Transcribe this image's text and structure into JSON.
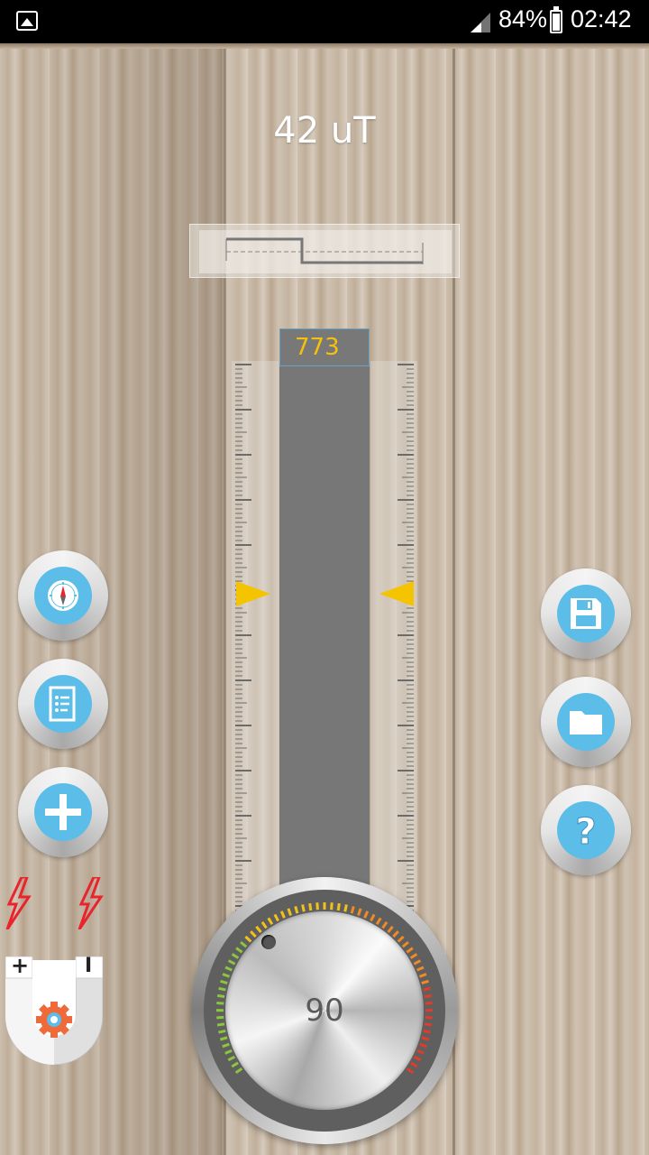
{
  "status_bar": {
    "battery_percent": "84%",
    "time": "02:42"
  },
  "meter": {
    "reading": "42 uT",
    "bar_value": "773",
    "dial_value": "90"
  },
  "left_buttons": [
    {
      "name": "compass-button",
      "icon": "compass-icon"
    },
    {
      "name": "notes-button",
      "icon": "document-list-icon"
    },
    {
      "name": "add-button",
      "icon": "plus-icon"
    }
  ],
  "right_buttons": [
    {
      "name": "save-button",
      "icon": "floppy-disk-icon"
    },
    {
      "name": "open-folder-button",
      "icon": "folder-icon"
    },
    {
      "name": "help-button",
      "icon": "question-mark-icon"
    }
  ],
  "magnet": {
    "plus_label": "+",
    "minus_label": "I"
  },
  "colors": {
    "accent_blue": "#5bbde8",
    "value_yellow": "#f6c10c",
    "arrow_yellow": "#f5c400",
    "bolt_red": "#e8242c",
    "bar_gray": "#777777"
  }
}
